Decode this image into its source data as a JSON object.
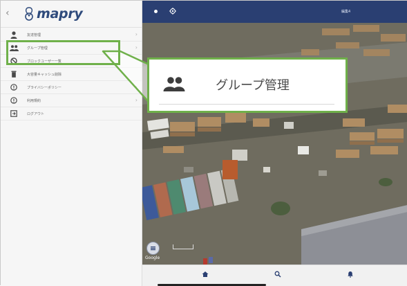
{
  "sidebar": {
    "logo_text": "mapry",
    "items": [
      {
        "label": "友達管理",
        "icon": "person-icon",
        "has_chevron": true
      },
      {
        "label": "グループ管理",
        "icon": "group-icon",
        "has_chevron": true
      },
      {
        "label": "ブロックユーザー一覧",
        "icon": "block-icon",
        "has_chevron": false
      },
      {
        "label": "大容量キャッシュ削除",
        "icon": "trash-icon",
        "has_chevron": false
      },
      {
        "label": "プライバシーポリシー",
        "icon": "info-icon",
        "has_chevron": true
      },
      {
        "label": "利用規約",
        "icon": "info-icon",
        "has_chevron": true
      },
      {
        "label": "ログアウト",
        "icon": "logout-icon",
        "has_chevron": false
      }
    ]
  },
  "map": {
    "topbar_title": "編集4",
    "attribution": "Google"
  },
  "callout": {
    "label": "グループ管理",
    "icon": "group-icon"
  },
  "colors": {
    "topbar": "#2a3f72",
    "highlight": "#6fb04a",
    "logo": "#2f4b7c"
  }
}
